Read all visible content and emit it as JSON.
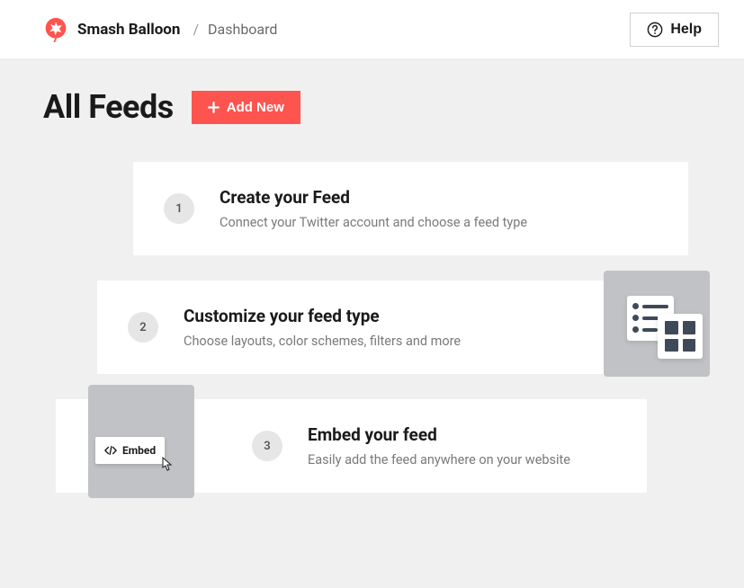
{
  "header": {
    "brand_name": "Smash Balloon",
    "separator": "/",
    "breadcrumb": "Dashboard",
    "help_label": "Help"
  },
  "page": {
    "title": "All Feeds",
    "add_new_label": "Add New"
  },
  "steps": [
    {
      "num": "1",
      "title": "Create your Feed",
      "desc": "Connect your Twitter account and choose a feed type"
    },
    {
      "num": "2",
      "title": "Customize your feed type",
      "desc": "Choose layouts, color schemes, filters and more"
    },
    {
      "num": "3",
      "title": "Embed your feed",
      "desc": "Easily add the feed anywhere on your website"
    }
  ],
  "illustration": {
    "embed_chip": "Embed"
  }
}
